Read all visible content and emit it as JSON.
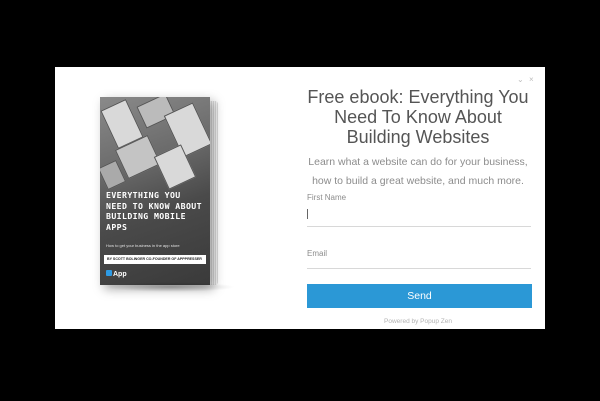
{
  "window_controls": {
    "minimize": "⌄",
    "close": "×"
  },
  "book": {
    "title": "EVERYTHING YOU NEED TO KNOW ABOUT BUILDING MOBILE APPS",
    "subtitle": "How to get your business in the app store",
    "author": "BY SCOTT BOLINGER CO-FOUNDER OF APPPRESSER",
    "logo": "App"
  },
  "form": {
    "heading": "Free ebook: Everything You Need To Know About Building Websites",
    "description": "Learn what a website can do for your business, how to build a great website, and much more.",
    "first_name_label": "First Name",
    "first_name_value": "",
    "email_label": "Email",
    "email_value": "",
    "submit_label": "Send"
  },
  "footer": {
    "powered_by": "Powered by Popup Zen"
  },
  "colors": {
    "button": "#2b98d6",
    "overlay": "#000000"
  }
}
